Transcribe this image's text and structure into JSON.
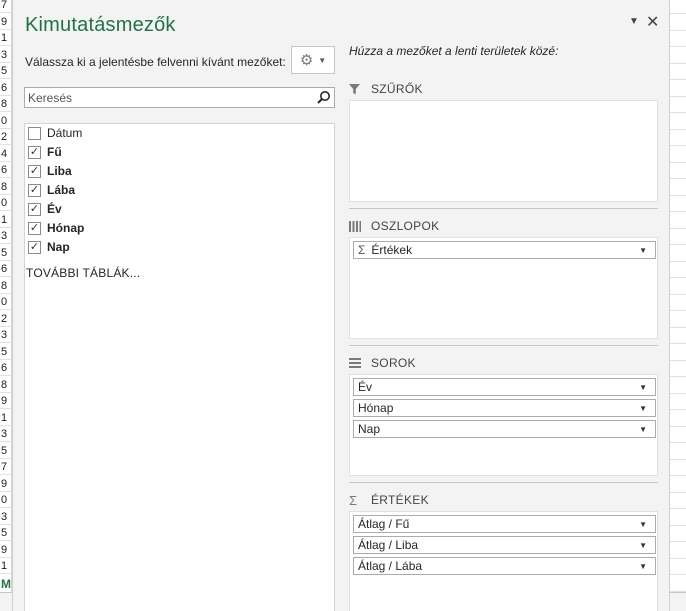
{
  "sheet": {
    "row_digits": [
      "7",
      "9",
      "1",
      "3",
      "5",
      "6",
      "8",
      "0",
      "2",
      "4",
      "6",
      "8",
      "0",
      "1",
      "3",
      "5",
      "6",
      "8",
      "0",
      "2",
      "3",
      "5",
      "6",
      "8",
      "9",
      "1",
      "3",
      "5",
      "7",
      "9",
      "0",
      "3",
      "5",
      "9",
      "1"
    ],
    "sheet_tab_char": "M"
  },
  "pane": {
    "title": "Kimutatásmezők",
    "dropdown_icon": "chevron-down-icon",
    "close_icon": "close-icon",
    "choose_label": "Válassza ki a jelentésbe felvenni kívánt mezőket:",
    "search_placeholder": "Keresés",
    "drag_label": "Húzza a mezőket a lenti területek közé:",
    "fields": [
      {
        "label": "Dátum",
        "checked": false
      },
      {
        "label": "Fű",
        "checked": true
      },
      {
        "label": "Liba",
        "checked": true
      },
      {
        "label": "Lába",
        "checked": true
      },
      {
        "label": "Év",
        "checked": true
      },
      {
        "label": "Hónap",
        "checked": true
      },
      {
        "label": "Nap",
        "checked": true
      }
    ],
    "more_tables": "TOVÁBBI TÁBLÁK...",
    "areas": {
      "filters": {
        "label": "SZŰRŐK",
        "icon": "filter-icon",
        "items": []
      },
      "columns": {
        "label": "OSZLOPOK",
        "icon": "columns-icon",
        "items": [
          "Értékek"
        ]
      },
      "rows": {
        "label": "SOROK",
        "icon": "rows-icon",
        "items": [
          "Év",
          "Hónap",
          "Nap"
        ]
      },
      "values": {
        "label": "ÉRTÉKEK",
        "icon": "sigma-icon",
        "items": [
          "Átlag / Fű",
          "Átlag / Liba",
          "Átlag / Lába"
        ]
      }
    }
  }
}
